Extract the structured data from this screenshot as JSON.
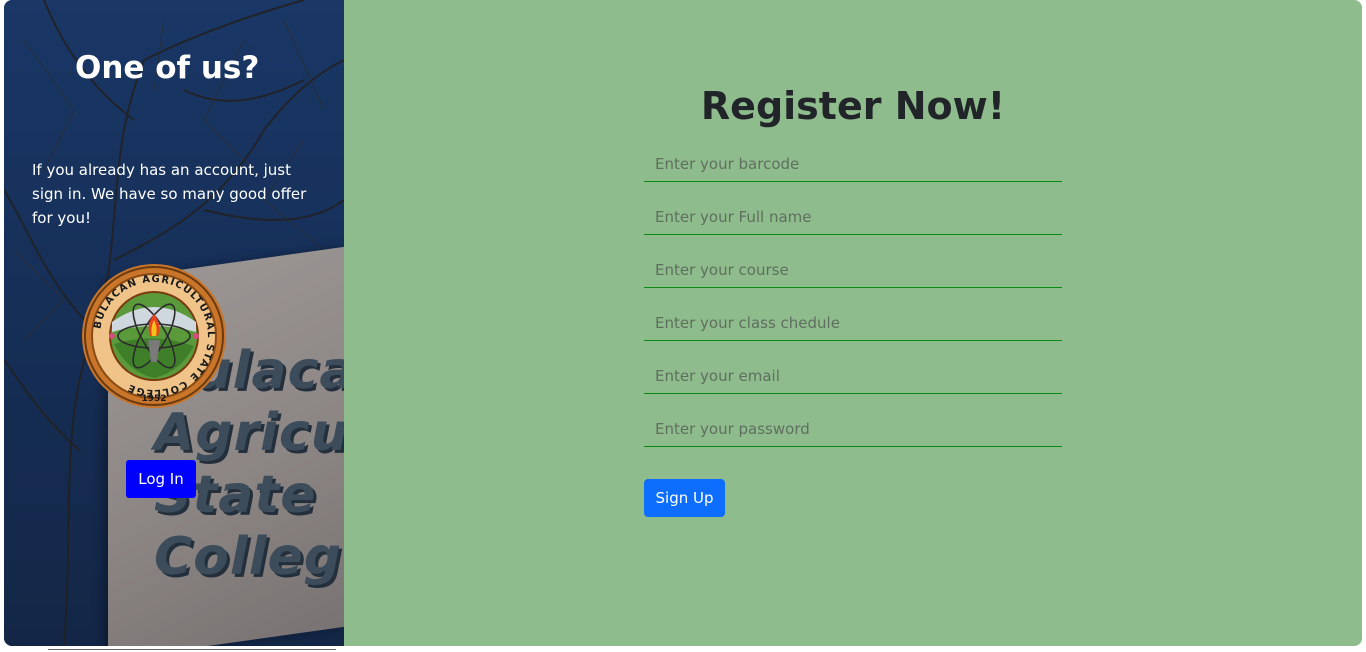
{
  "left_panel": {
    "title": "One of us?",
    "message": "If you already has an account, just sign in. We have so many good offer for you!",
    "login_label": "Log In",
    "building_sign": "Bulacan Agricultural State College",
    "seal_text": "BULACAN AGRICULTURAL STATE COLLEGE",
    "seal_year": "1952"
  },
  "register": {
    "title": "Register Now!",
    "fields": {
      "barcode": "Enter your barcode",
      "fullname": "Enter your Full name",
      "course": "Enter your course",
      "schedule": "Enter your class chedule",
      "email": "Enter your email",
      "password": "Enter your password"
    },
    "signup_label": "Sign Up"
  },
  "colors": {
    "right_bg": "#8fbc8c",
    "field_underline": "#0b8a12",
    "login_button": "#0000ff",
    "signup_button": "#0d6efd"
  }
}
